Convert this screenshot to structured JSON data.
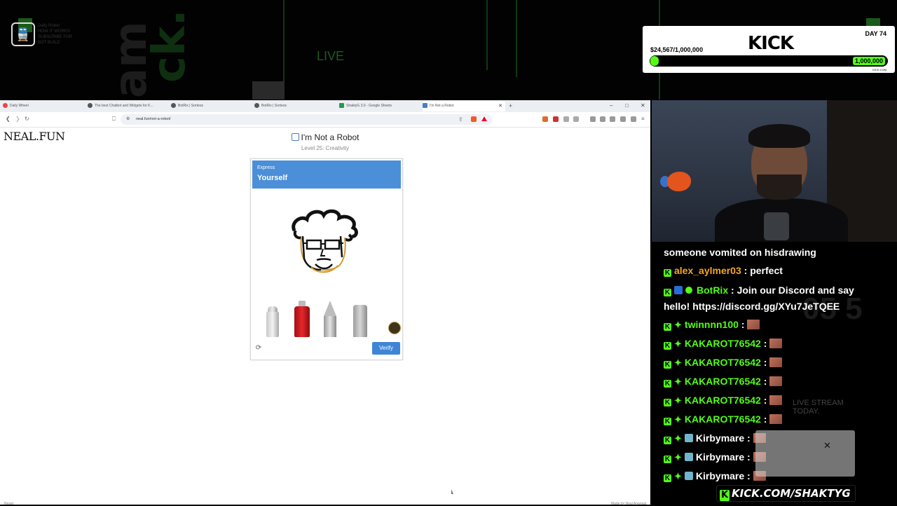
{
  "colors": {
    "kick_green": "#53fc18",
    "captcha_header": "#4a8fd8",
    "verify_button": "#3f85d6"
  },
  "stream": {
    "logo_icon": "train-icon",
    "logo_text": "Daily Robot\nHOW IT WORKS\nSUBSCRIBE FOR\nBOT BUILD",
    "live_label": "LIVE"
  },
  "kick_goal": {
    "logo": "KICK",
    "day": "DAY 74",
    "amount": "$24,567/1,000,000",
    "progress_fraction": 0.025,
    "target": "1,000,000",
    "site": "KICK.COM"
  },
  "browser": {
    "tabs": [
      {
        "label": "Daily Wheel",
        "icon": "chrome-icon"
      },
      {
        "label": "The best Chatbot and Widgets for K...",
        "icon": "site-icon"
      },
      {
        "label": "BotRix | Sorteos",
        "icon": "site-icon"
      },
      {
        "label": "BotRix | Sorteos",
        "icon": "site-icon"
      },
      {
        "label": "ShaktyG 3.0 - Google Sheets",
        "icon": "sheets-icon"
      },
      {
        "label": "I'm Not a Robot",
        "icon": "robot-icon"
      }
    ],
    "new_tab": "+",
    "window_controls": {
      "minimize": "–",
      "maximize": "□",
      "close": "✕"
    },
    "url": "neal.fun/not-a-robot/"
  },
  "page": {
    "site_logo": "NEAL.FUN",
    "title": "I'm Not a Robot",
    "level": "Level 25: Creativity",
    "captcha": {
      "header_small": "Express",
      "header_big": "Yourself",
      "tools": [
        "brush",
        "spray-can",
        "pencil",
        "marker"
      ],
      "selected_color": "#3f3318",
      "verify_label": "Verify"
    },
    "footer_left": "Reset",
    "footer_right": "Made by Neal Agarwal"
  },
  "chat": {
    "messages": [
      {
        "user": "",
        "text": "someone vomited on hisdrawing",
        "user_color": "#ffffff",
        "badges": []
      },
      {
        "user": "alex_aylmer03",
        "text": " : perfect",
        "user_color": "#f5a623",
        "badges": [
          "kick"
        ]
      },
      {
        "user": "BotRix",
        "text": " : Join our Discord and say hello! https://discord.gg/XYu7JeTQEE",
        "user_color": "#53fc18",
        "badges": [
          "kick",
          "bot",
          "verified"
        ]
      },
      {
        "user": "twinnnn100",
        "text": " :",
        "user_color": "#53fc18",
        "badges": [
          "kick",
          "sub"
        ]
      },
      {
        "user": "KAKAROT76542",
        "text": " :",
        "user_color": "#53fc18",
        "badges": [
          "kick",
          "sub"
        ]
      },
      {
        "user": "KAKAROT76542",
        "text": " :",
        "user_color": "#53fc18",
        "badges": [
          "kick",
          "sub"
        ]
      },
      {
        "user": "KAKAROT76542",
        "text": " :",
        "user_color": "#53fc18",
        "badges": [
          "kick",
          "sub"
        ]
      },
      {
        "user": "KAKAROT76542",
        "text": " :",
        "user_color": "#53fc18",
        "badges": [
          "kick",
          "sub"
        ]
      },
      {
        "user": "KAKAROT76542",
        "text": " :",
        "user_color": "#53fc18",
        "badges": [
          "kick",
          "sub"
        ]
      },
      {
        "user": "Kirbymare",
        "text": " :",
        "user_color": "#ffffff",
        "badges": [
          "kick",
          "sub",
          "gamer"
        ]
      },
      {
        "user": "Kirbymare",
        "text": " :",
        "user_color": "#ffffff",
        "badges": [
          "kick",
          "sub",
          "gamer"
        ]
      },
      {
        "user": "Kirbymare",
        "text": " :",
        "user_color": "#ffffff",
        "badges": [
          "kick",
          "sub",
          "gamer"
        ]
      }
    ],
    "overlay_text": "LIVE STREAM\nTODAY.",
    "background_number": "05 5",
    "channel_url": "KICK.COM/SHAKTYG"
  }
}
